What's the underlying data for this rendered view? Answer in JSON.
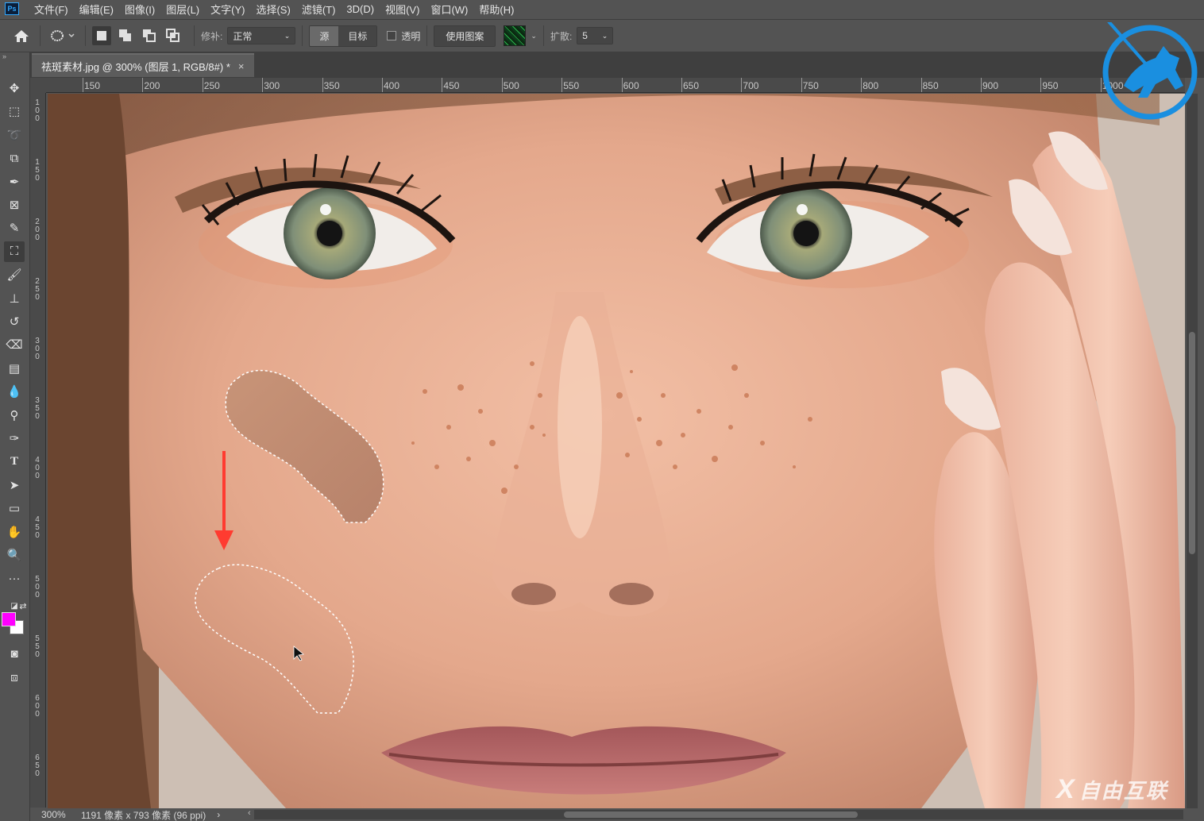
{
  "menubar": {
    "app_badge": "Ps",
    "items": [
      "文件(F)",
      "编辑(E)",
      "图像(I)",
      "图层(L)",
      "文字(Y)",
      "选择(S)",
      "滤镜(T)",
      "3D(D)",
      "视图(V)",
      "窗口(W)",
      "帮助(H)"
    ]
  },
  "options": {
    "patch_label": "修补:",
    "patch_mode": "正常",
    "source_label": "源",
    "target_label": "目标",
    "transparent_label": "透明",
    "use_pattern_label": "使用图案",
    "diffusion_label": "扩散:",
    "diffusion_value": "5"
  },
  "document": {
    "tab_title": "祛斑素材.jpg @ 300% (图层 1, RGB/8#) *",
    "close_glyph": "×"
  },
  "rulers": {
    "horizontal": [
      "150",
      "200",
      "250",
      "300",
      "350",
      "400",
      "450",
      "500",
      "550",
      "600",
      "650",
      "700",
      "750",
      "800",
      "850",
      "900",
      "950",
      "1000"
    ],
    "vertical": [
      "100",
      "150",
      "200",
      "250",
      "300",
      "350",
      "400",
      "450",
      "500",
      "550",
      "600",
      "650"
    ]
  },
  "status": {
    "zoom": "300%",
    "doc_info": "1191 像素 x 793 像素 (96 ppi)",
    "more_arrow": "›"
  },
  "colors": {
    "foreground": "#ff00ff",
    "background": "#ffffff",
    "annotation_arrow": "#ff3b30"
  },
  "tools": [
    {
      "name": "move-tool-icon",
      "glyph": "✥"
    },
    {
      "name": "rectangular-marquee-tool-icon",
      "glyph": "⬚"
    },
    {
      "name": "lasso-tool-icon",
      "glyph": "➰"
    },
    {
      "name": "object-selection-tool-icon",
      "glyph": "⧉"
    },
    {
      "name": "eyedropper-tool-icon",
      "glyph": "✒"
    },
    {
      "name": "frame-tool-icon",
      "glyph": "⊠"
    },
    {
      "name": "spot-healing-brush-icon",
      "glyph": "✎"
    },
    {
      "name": "patch-tool-icon",
      "glyph": "⛶"
    },
    {
      "name": "brush-tool-icon",
      "glyph": "🖌"
    },
    {
      "name": "clone-stamp-tool-icon",
      "glyph": "⊥"
    },
    {
      "name": "history-brush-tool-icon",
      "glyph": "↺"
    },
    {
      "name": "eraser-tool-icon",
      "glyph": "⌫"
    },
    {
      "name": "gradient-tool-icon",
      "glyph": "▤"
    },
    {
      "name": "blur-tool-icon",
      "glyph": "💧"
    },
    {
      "name": "dodge-tool-icon",
      "glyph": "⚲"
    },
    {
      "name": "pen-tool-icon",
      "glyph": "✑"
    },
    {
      "name": "type-tool-icon",
      "glyph": "T"
    },
    {
      "name": "path-selection-tool-icon",
      "glyph": "➤"
    },
    {
      "name": "rectangle-tool-icon",
      "glyph": "▭"
    },
    {
      "name": "hand-tool-icon",
      "glyph": "✋"
    },
    {
      "name": "zoom-tool-icon",
      "glyph": "🔍"
    },
    {
      "name": "more-tools-icon",
      "glyph": "···"
    }
  ],
  "bottom_watermark": "自由互联"
}
